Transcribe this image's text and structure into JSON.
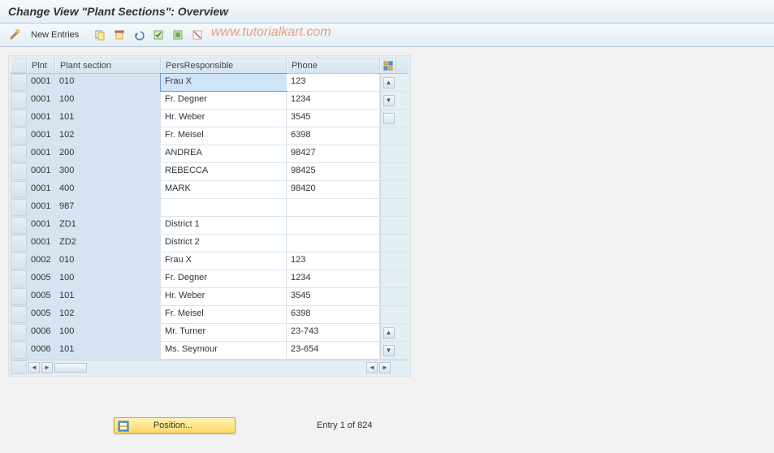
{
  "title": "Change View \"Plant Sections\": Overview",
  "watermark": "www.tutorialkart.com",
  "toolbar": {
    "new_entries": "New Entries"
  },
  "columns": {
    "plnt": "Plnt",
    "plant_section": "Plant section",
    "pers_responsible": "PersResponsible",
    "phone": "Phone"
  },
  "rows": [
    {
      "plnt": "0001",
      "ps": "010",
      "pr": "Frau X",
      "ph": "123",
      "focused": true
    },
    {
      "plnt": "0001",
      "ps": "100",
      "pr": "Fr. Degner",
      "ph": "1234"
    },
    {
      "plnt": "0001",
      "ps": "101",
      "pr": "Hr. Weber",
      "ph": "3545"
    },
    {
      "plnt": "0001",
      "ps": "102",
      "pr": "Fr. Meisel",
      "ph": "6398"
    },
    {
      "plnt": "0001",
      "ps": "200",
      "pr": "ANDREA",
      "ph": "98427"
    },
    {
      "plnt": "0001",
      "ps": "300",
      "pr": "REBECCA",
      "ph": "98425"
    },
    {
      "plnt": "0001",
      "ps": "400",
      "pr": "MARK",
      "ph": "98420"
    },
    {
      "plnt": "0001",
      "ps": "987",
      "pr": "",
      "ph": ""
    },
    {
      "plnt": "0001",
      "ps": "ZD1",
      "pr": "District 1",
      "ph": ""
    },
    {
      "plnt": "0001",
      "ps": "ZD2",
      "pr": "District 2",
      "ph": ""
    },
    {
      "plnt": "0002",
      "ps": "010",
      "pr": "Frau X",
      "ph": "123"
    },
    {
      "plnt": "0005",
      "ps": "100",
      "pr": "Fr. Degner",
      "ph": "1234"
    },
    {
      "plnt": "0005",
      "ps": "101",
      "pr": "Hr. Weber",
      "ph": "3545"
    },
    {
      "plnt": "0005",
      "ps": "102",
      "pr": "Fr. Meisel",
      "ph": "6398"
    },
    {
      "plnt": "0006",
      "ps": "100",
      "pr": "Mr. Turner",
      "ph": "23-743"
    },
    {
      "plnt": "0006",
      "ps": "101",
      "pr": "Ms. Seymour",
      "ph": "23-654"
    }
  ],
  "footer": {
    "position_label": "Position...",
    "entry_text": "Entry 1 of 824"
  }
}
